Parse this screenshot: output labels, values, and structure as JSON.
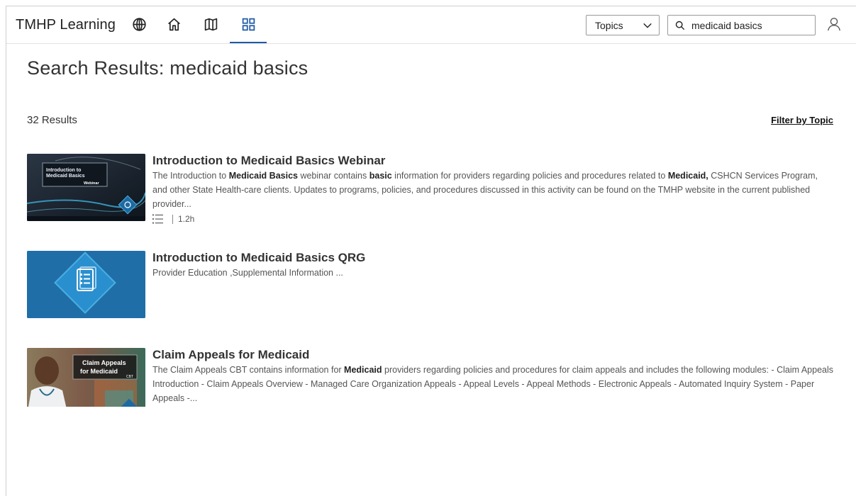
{
  "header": {
    "brand": "TMHP Learning",
    "nav_icons": [
      "globe-icon",
      "home-icon",
      "map-icon",
      "grid-icon"
    ],
    "active_nav": "grid-icon",
    "topics_select": {
      "value": "Topics"
    },
    "search": {
      "value": "medicaid basics",
      "placeholder": "Search"
    }
  },
  "page": {
    "title": "Search Results: medicaid basics",
    "results_count": "32 Results",
    "filter_link": "Filter by Topic"
  },
  "results": [
    {
      "title": "Introduction to Medicaid Basics Webinar",
      "thumb_text": [
        "Introduction to",
        "Medicaid Basics",
        "Webinar"
      ],
      "desc_parts": [
        {
          "t": "The Introduction to "
        },
        {
          "t": "Medicaid Basics",
          "b": true
        },
        {
          "t": " webinar contains "
        },
        {
          "t": "basic",
          "b": true
        },
        {
          "t": " information for providers regarding policies and procedures related to "
        },
        {
          "t": "Medicaid,",
          "b": true
        },
        {
          "t": " CSHCN Services Program, and other State Health-care clients. Updates to programs, policies, and procedures discussed in this activity can be found on the TMHP website in the current published provider..."
        }
      ],
      "duration": "1.2h"
    },
    {
      "title": "Introduction to Medicaid Basics QRG",
      "desc_parts": [
        {
          "t": "Provider Education ,Supplemental Information ..."
        }
      ]
    },
    {
      "title": "Claim Appeals for Medicaid",
      "thumb_text": [
        "Claim Appeals",
        "for Medicaid",
        "CBT"
      ],
      "desc_parts": [
        {
          "t": "The Claim Appeals CBT contains information for "
        },
        {
          "t": "Medicaid",
          "b": true
        },
        {
          "t": " providers regarding policies and procedures for claim appeals and includes the following modules: - Claim Appeals Introduction - Claim Appeals Overview - Managed Care Organization Appeals - Appeal Levels - Appeal Methods - Electronic Appeals - Automated Inquiry System - Paper Appeals -..."
        }
      ]
    }
  ],
  "colors": {
    "accent": "#1e5aa8",
    "thumb_blue": "#1d6aa3",
    "thumb_dark": "#1a2633"
  }
}
